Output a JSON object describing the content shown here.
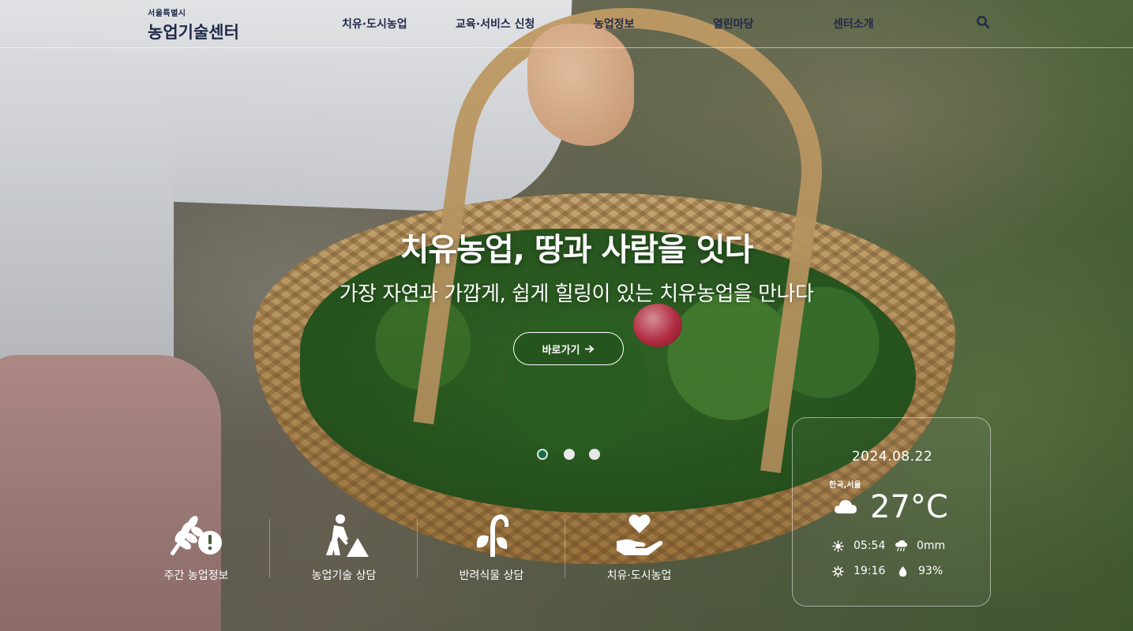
{
  "header": {
    "logo_small": "서울특별시",
    "logo_main": "농업기술센터",
    "nav": [
      "치유·도시농업",
      "교육·서비스 신청",
      "농업정보",
      "열린마당",
      "센터소개"
    ],
    "search_icon": "search-icon"
  },
  "hero": {
    "title": "치유농업, 땅과 사람을 잇다",
    "subtitle": "가장 자연과 가깝게, 쉽게 힐링이 있는 치유농업을 만나다",
    "button_label": "바로가기",
    "button_icon": "arrow-right-icon",
    "slides_total": 3,
    "slide_active": 1,
    "accent_color": "#1a6b4a"
  },
  "quick_menu": [
    {
      "label": "주간 농업정보",
      "icon": "wheat-warning-icon"
    },
    {
      "label": "농업기술 상담",
      "icon": "farmer-digging-icon"
    },
    {
      "label": "반려식물 상담",
      "icon": "sprout-icon"
    },
    {
      "label": "치유·도시농업",
      "icon": "heart-hand-icon"
    }
  ],
  "weather": {
    "date": "2024.08.22",
    "location": "한국,서울",
    "temperature": "27°C",
    "condition_icon": "cloud-icon",
    "sunrise": "05:54",
    "sunset": "19:16",
    "rainfall": "0mm",
    "humidity": "93%"
  }
}
